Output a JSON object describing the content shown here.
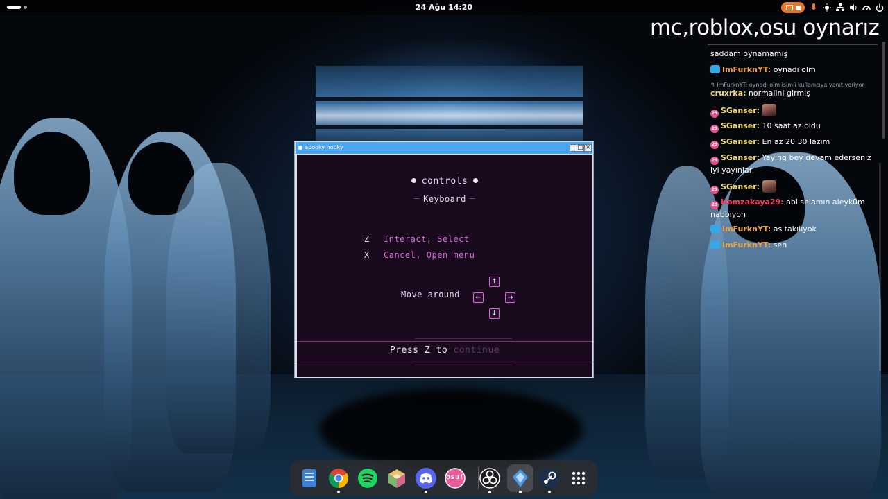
{
  "topbar": {
    "clock": "24 Ağu  14:20"
  },
  "overlay": {
    "title": "mc,roblox,osu oynarız",
    "chat": [
      {
        "user": "",
        "text": "saddam oynamamış",
        "badge": "none"
      },
      {
        "user": "ImFurknYT:",
        "text": " oynadı olm",
        "badge": "kick",
        "user_color": "orange"
      },
      {
        "reply": "ImFurknYT: oynadı olm isimli kullanıcıya yanıt veriyor"
      },
      {
        "user": "cruxrka:",
        "text": " normalini girmiş",
        "badge": "none",
        "user_color": "yellow"
      },
      {
        "user": "SGanser:",
        "text": " ",
        "badge": "sub",
        "user_color": "yellow",
        "emote": true
      },
      {
        "user": "SGanser:",
        "text": " 10 saat az oldu",
        "badge": "sub",
        "user_color": "yellow"
      },
      {
        "user": "SGanser:",
        "text": " En az 20 30 lazım",
        "badge": "sub",
        "user_color": "yellow"
      },
      {
        "user": "SGanser:",
        "text": " Yaying bey devam ederseniz iyi yayınlar",
        "badge": "sub",
        "user_color": "yellow"
      },
      {
        "user": "SGanser:",
        "text": " ",
        "badge": "sub",
        "user_color": "yellow",
        "emote": true
      },
      {
        "user": "Hamzakaya29:",
        "text": " abi selamın aleyküm nabbıyon",
        "badge": "sub",
        "user_color": "red"
      },
      {
        "user": "ImFurknYT:",
        "text": " as takılıyok",
        "badge": "kick",
        "user_color": "orange"
      },
      {
        "user": "ImFurknYT:",
        "text": " sen",
        "badge": "kick",
        "user_color": "orange"
      }
    ]
  },
  "window": {
    "title": "spooky hooky",
    "minimize": "_",
    "maximize": "□",
    "close": "✕"
  },
  "game": {
    "title": "controls",
    "subtitle": "Keyboard",
    "controls": [
      {
        "key": "Z",
        "action": "Interact, Select"
      },
      {
        "key": "X",
        "action": "Cancel, Open menu"
      }
    ],
    "move_label": "Move around",
    "arrows": {
      "up": "↑",
      "left": "←",
      "right": "→",
      "down": "↓"
    },
    "press_prefix": "Press Z to",
    "press_action": "continue"
  },
  "dock": {
    "apps": [
      "files-icon",
      "chrome-icon",
      "spotify-icon",
      "cube-icon",
      "discord-icon",
      "osu-icon",
      "obs-icon",
      "app-icon",
      "steam-icon",
      "app-grid-icon"
    ],
    "osu_label": "osu!"
  },
  "colors": {
    "titlebar": "#4aa6f2",
    "game_bg": "#1a0a1e",
    "game_accent": "#d36bd7",
    "recording": "#e8772e"
  }
}
